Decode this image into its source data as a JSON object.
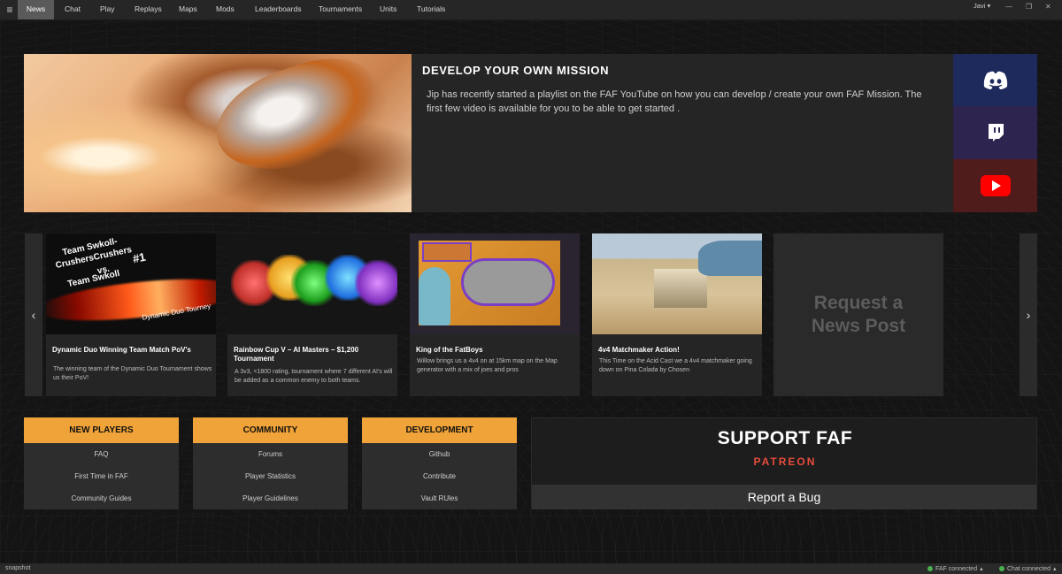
{
  "nav": {
    "menu_icon": "hamburger-icon",
    "tabs": [
      {
        "label": "News",
        "active": true
      },
      {
        "label": "Chat"
      },
      {
        "label": "Play"
      },
      {
        "label": "Replays"
      },
      {
        "label": "Maps"
      },
      {
        "label": "Mods"
      },
      {
        "label": "Leaderboards"
      },
      {
        "label": "Tournaments"
      },
      {
        "label": "Units"
      },
      {
        "label": "Tutorials"
      }
    ],
    "user": "Javi"
  },
  "hero": {
    "title": "DEVELOP YOUR OWN MISSION",
    "body": "Jip has recently started a playlist on the FAF YouTube on how you can develop / create your own FAF Mission. The first few video is available for you to be able to get started ."
  },
  "colors": {
    "accent": "#f0a338",
    "patreon": "#e84b3c",
    "discord_bg": "#1f2a5c",
    "twitch_bg": "#2e2450",
    "youtube_bg": "#501b1b",
    "status_ok": "#4caf50"
  },
  "news_cards": [
    {
      "title": "Dynamic Duo Winning Team Match PoV's",
      "desc": "The winning team of the Dynamic Duo Tournament shows us their PoV!",
      "thumb_text": [
        "Team Swkoll-",
        "CrushersCrushers",
        "vs.",
        "Team Swkoll",
        "#1",
        "Dynamic Duo Tourney"
      ]
    },
    {
      "title": "Rainbow Cup V – AI Masters – $1,200 Tournament",
      "desc": "A 3v3, <1800 rating, tournament where 7 different AI's will be added as a common enemy to both teams."
    },
    {
      "title": "King of the FatBoys",
      "desc": "Willow brings us a 4v4 on at 15km map on the Map generator with a mix of joes and pros"
    },
    {
      "title": "4v4 Matchmaker Action!",
      "desc": "This Time on the Acid Cast we a 4v4 matchmaker going down on Pina Colada by Chosen"
    }
  ],
  "request_card": {
    "line1": "Request a",
    "line2": "News Post"
  },
  "links": {
    "new_players": {
      "header": "NEW PLAYERS",
      "items": [
        "FAQ",
        "First Time in FAF",
        "Community Guides"
      ]
    },
    "community": {
      "header": "COMMUNITY",
      "items": [
        "Forums",
        "Player Statistics",
        "Player Guidelines"
      ]
    },
    "development": {
      "header": "DEVELOPMENT",
      "items": [
        "Github",
        "Contribute",
        "Vault RUles"
      ]
    }
  },
  "support": {
    "title": "SUPPORT FAF",
    "patreon": "PATREON",
    "bug": "Report a Bug"
  },
  "status": {
    "left": "snapshot",
    "faf": "FAF connected",
    "chat": "Chat connected"
  }
}
